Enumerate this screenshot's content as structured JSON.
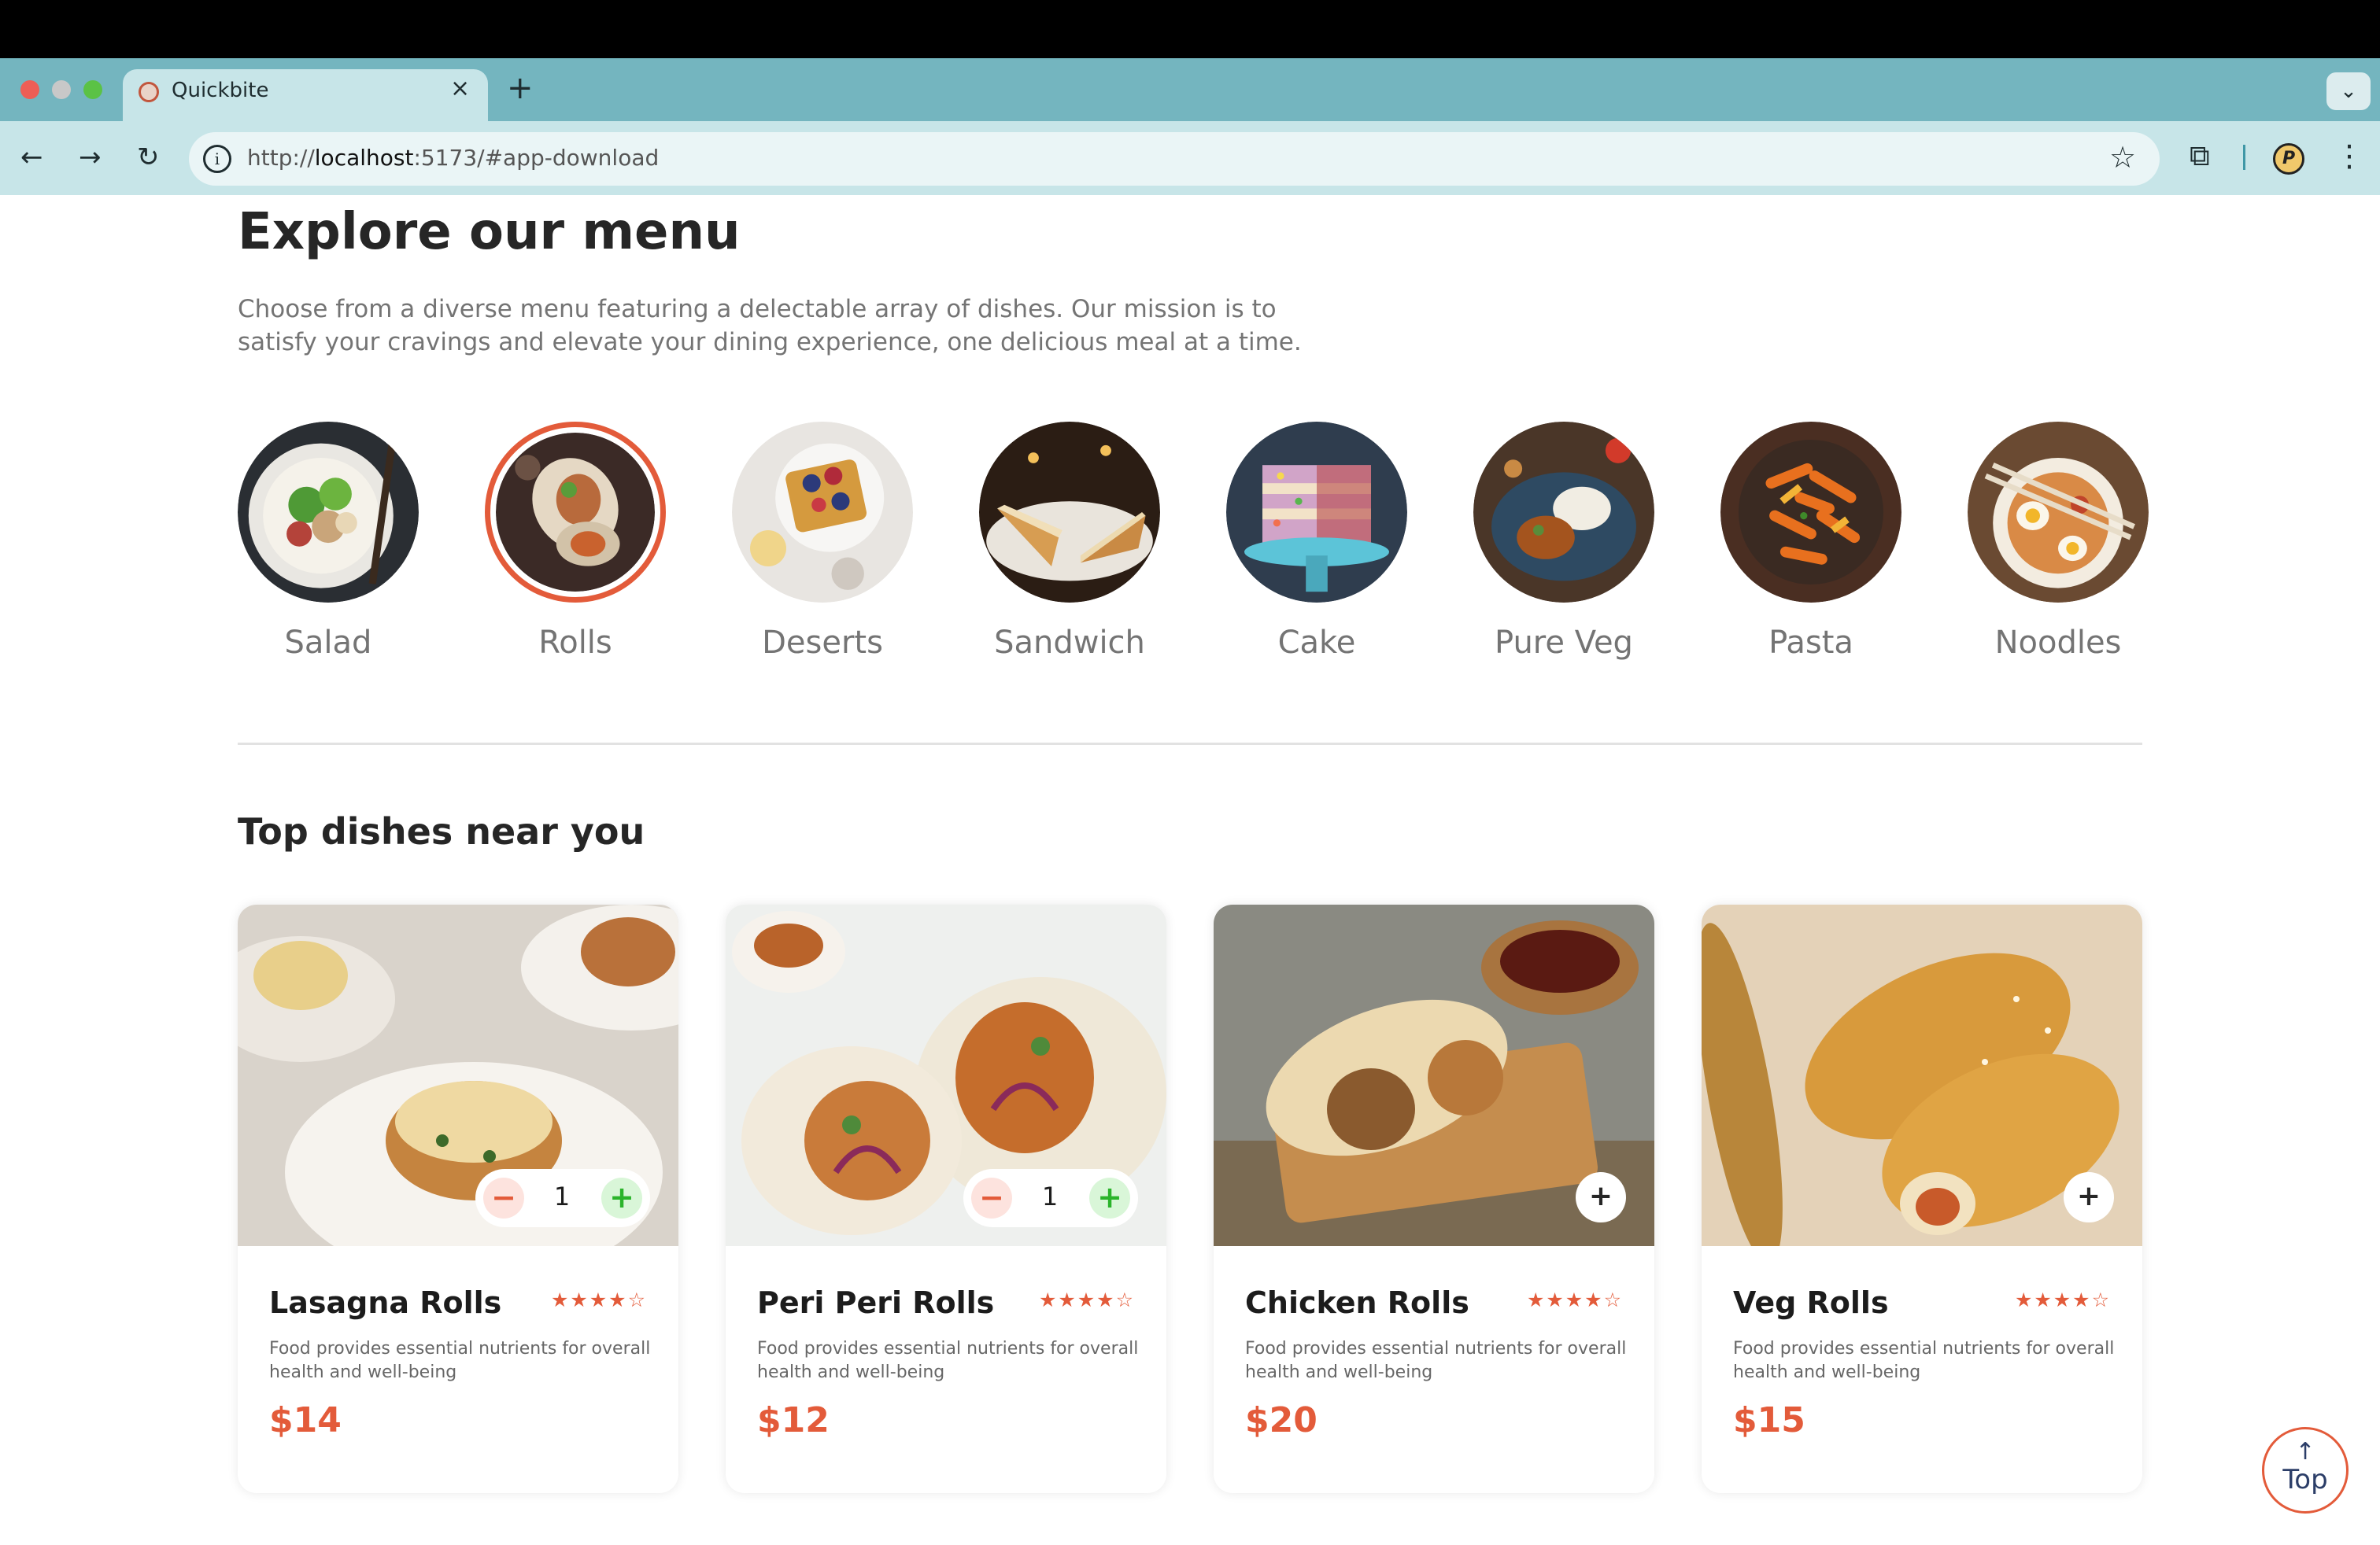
{
  "browser": {
    "tab_title": "Quickbite",
    "tab_close": "×",
    "new_tab": "+",
    "tab_menu": "⌄",
    "url_prefix": "http://",
    "url_host": "localhost",
    "url_rest": ":5173/#app-download",
    "nav_back": "←",
    "nav_forward": "→",
    "nav_reload": "↻",
    "info": "i",
    "star": "☆",
    "extensions": "⧉",
    "profile": "P",
    "more": "⋮"
  },
  "menu": {
    "title": "Explore our menu",
    "description": "Choose from a diverse menu featuring a delectable array of dishes. Our mission is to satisfy your cravings and elevate your dining experience, one delicious meal at a time.",
    "active_category": "Rolls",
    "categories": [
      {
        "label": "Salad",
        "icon": "salad-image"
      },
      {
        "label": "Rolls",
        "icon": "rolls-image"
      },
      {
        "label": "Deserts",
        "icon": "deserts-image"
      },
      {
        "label": "Sandwich",
        "icon": "sandwich-image"
      },
      {
        "label": "Cake",
        "icon": "cake-image"
      },
      {
        "label": "Pure Veg",
        "icon": "pure-veg-image"
      },
      {
        "label": "Pasta",
        "icon": "pasta-image"
      },
      {
        "label": "Noodles",
        "icon": "noodles-image"
      }
    ]
  },
  "top_dishes": {
    "title": "Top dishes near you",
    "items": [
      {
        "name": "Lasagna Rolls",
        "stars": "★★★★☆",
        "rating": 4,
        "description": "Food provides essential nutrients for overall health and well-being",
        "price": "$14",
        "quantity": "1",
        "minus": "−",
        "plus": "+"
      },
      {
        "name": "Peri Peri Rolls",
        "stars": "★★★★☆",
        "rating": 4,
        "description": "Food provides essential nutrients for overall health and well-being",
        "price": "$12",
        "quantity": "1",
        "minus": "−",
        "plus": "+"
      },
      {
        "name": "Chicken Rolls",
        "stars": "★★★★☆",
        "rating": 4,
        "description": "Food provides essential nutrients for overall health and well-being",
        "price": "$20",
        "add": "+"
      },
      {
        "name": "Veg Rolls",
        "stars": "★★★★☆",
        "rating": 4,
        "description": "Food provides essential nutrients for overall health and well-being",
        "price": "$15",
        "add": "+"
      }
    ]
  },
  "top_button": {
    "arrow": "↑",
    "label": "Top"
  },
  "colors": {
    "accent": "#e35b3a",
    "chrome": "#74b5bf",
    "toolbar": "#c7e5e8",
    "text_muted": "#747474"
  }
}
